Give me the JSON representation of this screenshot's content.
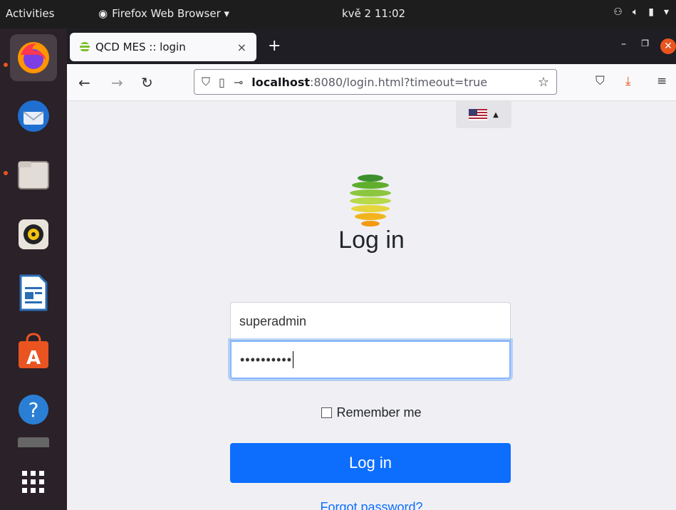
{
  "topbar": {
    "activities": "Activities",
    "app_menu": "Firefox Web Browser ▾",
    "clock": "kvě 2  11:02"
  },
  "dock": {
    "items": [
      "firefox-icon",
      "thunderbird-icon",
      "files-icon",
      "rhythmbox-icon",
      "writer-icon",
      "software-icon",
      "help-icon",
      "app-grid-icon"
    ]
  },
  "browser": {
    "tab_title": "QCD MES :: login",
    "tab_close": "×",
    "new_tab": "+",
    "url_host": "localhost",
    "url_rest": ":8080/login.html?timeout=true"
  },
  "page": {
    "title": "Log in",
    "username_value": "superadmin",
    "password_mask": "••••••••••",
    "remember_label": "Remember me",
    "login_button": "Log in",
    "forgot_link": "Forgot password?"
  },
  "colors": {
    "primary": "#0d6efd",
    "ubuntu_orange": "#e95420"
  }
}
